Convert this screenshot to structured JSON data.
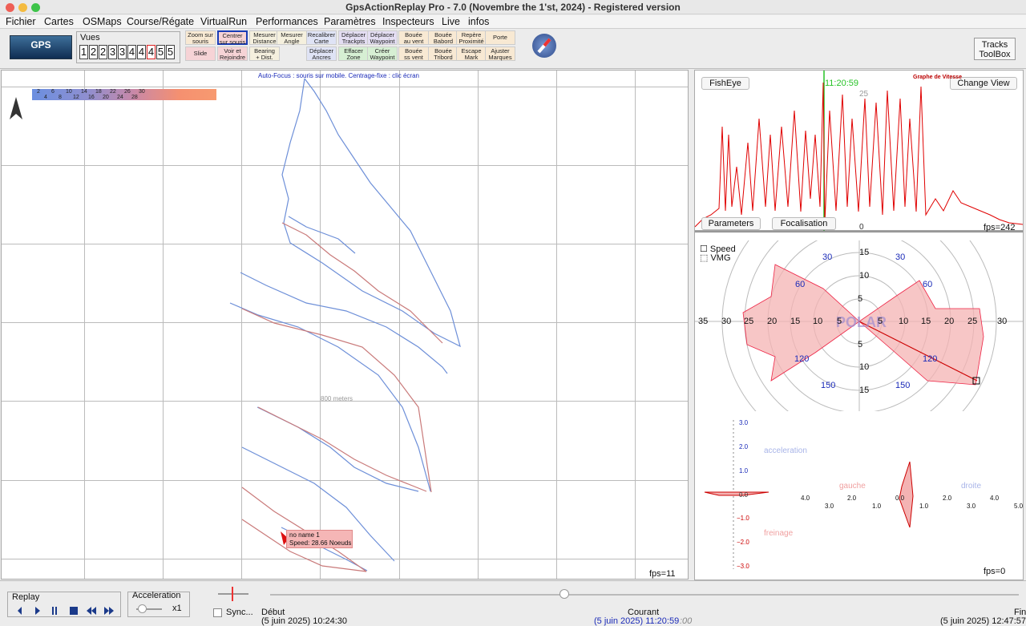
{
  "window": {
    "title": "GpsActionReplay Pro - 7.0  (Novembre the 1'st, 2024)  -  Registered version"
  },
  "menu": [
    "Fichier",
    "Cartes",
    "OSMaps",
    "Course/Régate",
    "VirtualRun",
    "Performances",
    "Paramètres",
    "Inspecteurs",
    "Live",
    "infos"
  ],
  "toolbar": {
    "logo": "GPS",
    "vues_label": "Vues",
    "vues": [
      "1",
      "2",
      "2",
      "3",
      "3",
      "4",
      "4",
      "4",
      "5",
      "5"
    ],
    "buttons": [
      {
        "l1": "Zoom sur",
        "l2": "souris"
      },
      {
        "l1": "Centrer",
        "l2": "sur souris"
      },
      {
        "l1": "Mesurer",
        "l2": "Distance"
      },
      {
        "l1": "Mesurer",
        "l2": "Angle"
      },
      {
        "l1": "Recalibrer",
        "l2": "Carte"
      },
      {
        "l1": "Déplacer",
        "l2": "Trackpts"
      },
      {
        "l1": "Déplacer",
        "l2": "Waypoint"
      },
      {
        "l1": "Bouée",
        "l2": "au vent"
      },
      {
        "l1": "Bouée",
        "l2": "Babord"
      },
      {
        "l1": "Repère",
        "l2": "Proximité"
      },
      {
        "l1": "Porte",
        "l2": ""
      },
      {
        "l1": "Slide",
        "l2": ""
      },
      {
        "l1": "Voir et",
        "l2": "Rejoindre"
      },
      {
        "l1": "Bearing",
        "l2": "+ Dist."
      },
      {
        "l1": "Déplacer",
        "l2": "Ancres"
      },
      {
        "l1": "Effacer",
        "l2": "Zone"
      },
      {
        "l1": "Créer",
        "l2": "Waypoint"
      },
      {
        "l1": "Bouée",
        "l2": "ss vent"
      },
      {
        "l1": "Bouée",
        "l2": "Tribord"
      },
      {
        "l1": "Escape",
        "l2": "Mark"
      },
      {
        "l1": "Ajuster",
        "l2": "Marques"
      }
    ],
    "tracks_l1": "Tracks",
    "tracks_l2": "ToolBox"
  },
  "map": {
    "autofocus": "Auto-Focus : souris sur mobile. Centrage-fixe : clic écran",
    "scale_top": [
      "2",
      "6",
      "10",
      "14",
      "18",
      "22",
      "26",
      "30"
    ],
    "scale_bottom": [
      "4",
      "8",
      "12",
      "16",
      "20",
      "24",
      "28"
    ],
    "meters": "800 meters",
    "fps": "fps=11",
    "boat_name": "no name 1",
    "boat_speed": "Speed: 28.66 Noeuds"
  },
  "graph": {
    "fisheye": "FishEye",
    "change_view": "Change View",
    "time": "11:20:59",
    "title": "Graphe de Vitesse",
    "tick25": "25",
    "tick0": "0",
    "parameters": "Parameters",
    "focalisation": "Focalisation",
    "fps": "fps=242"
  },
  "polar": {
    "speed": "Speed",
    "vmg": "VMG",
    "label": "POLAR",
    "h_ticks": [
      "35",
      "30",
      "25",
      "20",
      "15",
      "10",
      "5",
      "5",
      "10",
      "15",
      "20",
      "25",
      "30"
    ],
    "v_ticks": [
      "15",
      "10",
      "5",
      "5",
      "10",
      "15"
    ],
    "angles": [
      "30",
      "30",
      "60",
      "60",
      "120",
      "120",
      "150",
      "150"
    ]
  },
  "accel": {
    "acceleration": "acceleration",
    "freinage": "freinage",
    "gauche": "gauche",
    "droite": "droite",
    "y_ticks": [
      "3.0",
      "2.0",
      "1.0",
      "0.0",
      "−1.0",
      "−2.0",
      "−3.0"
    ],
    "x_top": [
      "4.0",
      "2.0",
      "0.0",
      "2.0",
      "4.0"
    ],
    "x_bottom": [
      "3.0",
      "1.0",
      "1.0",
      "3.0",
      "5.0"
    ],
    "fps": "fps=0"
  },
  "bottom": {
    "replay": "Replay",
    "acceleration": "Acceleration",
    "x1": "x1",
    "sync": "Sync...",
    "debut": "Début",
    "debut_time": "(5 juin 2025) 10:24:30",
    "courant": "Courant",
    "courant_time": "(5 juin 2025) 11:20:59",
    "courant_ms": ":00",
    "fin": "Fin",
    "fin_time": "(5 juin 2025) 12:47:57"
  },
  "colors": {
    "track_blue": "#6d8fd8",
    "track_red": "#c97a7a",
    "speed_line": "#e00000",
    "focus_line": "#27c427",
    "polar_fill": "#f4b3b3"
  }
}
